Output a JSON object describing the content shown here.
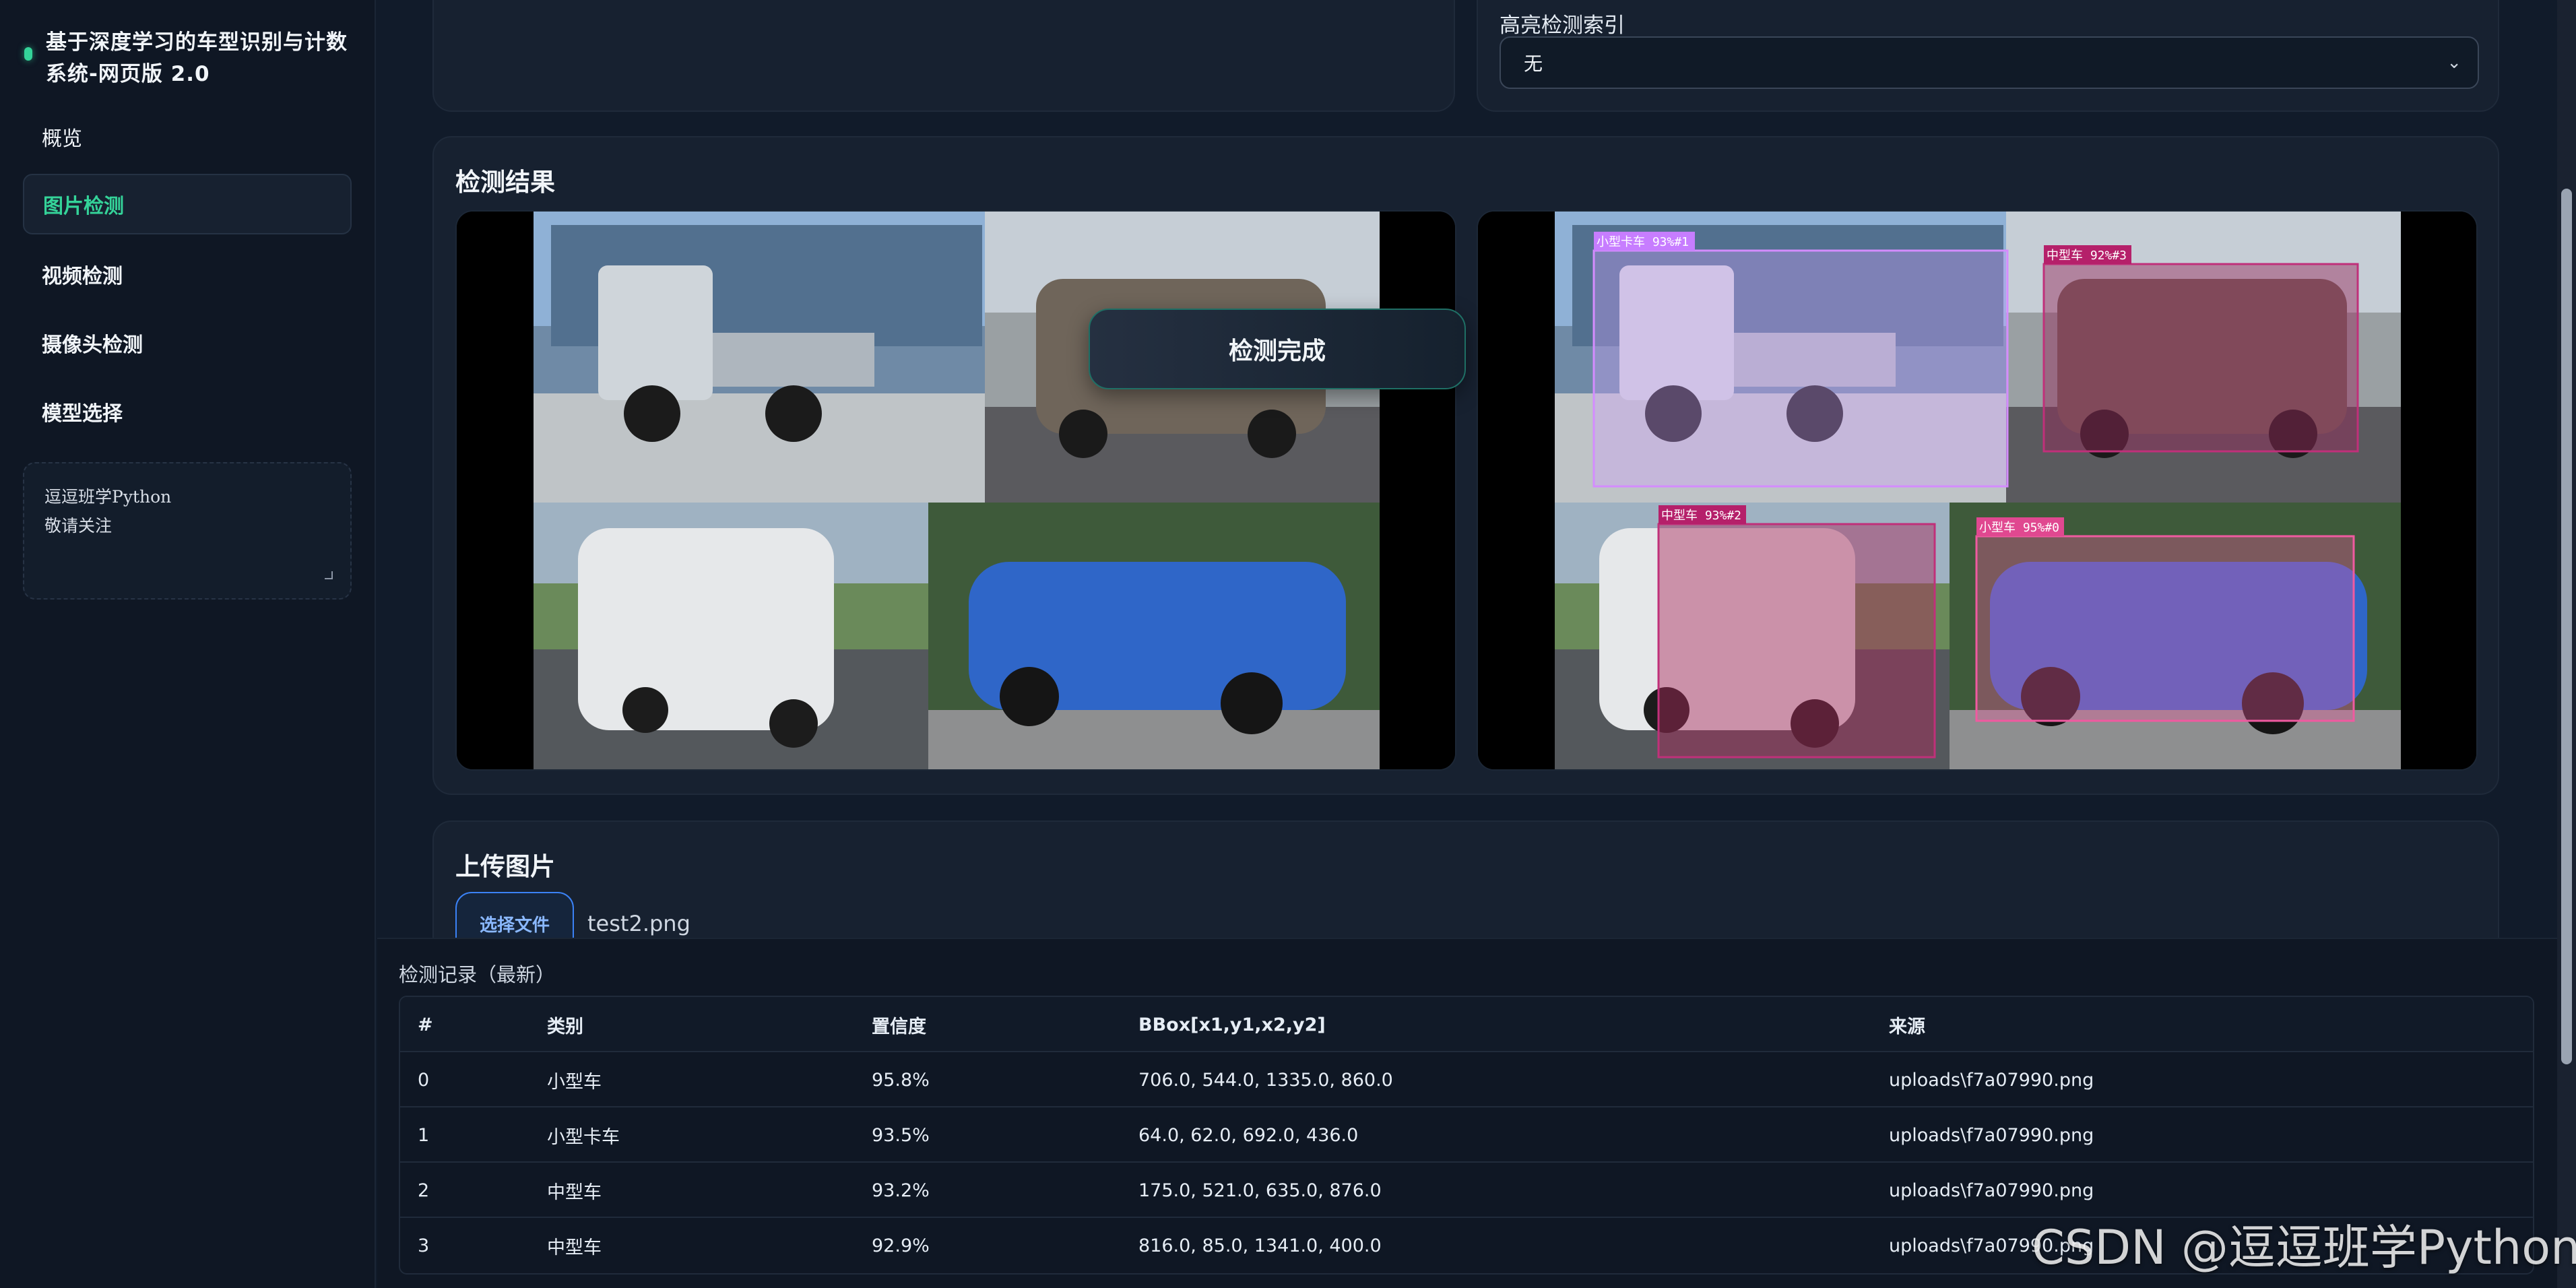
{
  "sidebar": {
    "brand_title": "基于深度学习的车型识别与计数系统-网页版 2.0",
    "items": [
      {
        "label": "概览"
      },
      {
        "label": "图片检测"
      },
      {
        "label": "视频检测"
      },
      {
        "label": "摄像头检测"
      },
      {
        "label": "模型选择"
      }
    ],
    "note_text": "逗逗班学Python\n敬请关注"
  },
  "main": {
    "highlight_label": "高亮检测索引",
    "highlight_value": "无"
  },
  "detection_results": {
    "title": "检测结果",
    "toast": "检测完成",
    "annotations": [
      {
        "label": "小型卡车 93%#1"
      },
      {
        "label": "中型车 92%#3"
      },
      {
        "label": "中型车 93%#2"
      },
      {
        "label": "小型车 95%#0"
      }
    ]
  },
  "upload_section": {
    "title": "上传图片",
    "choose_file": "选择文件",
    "file_name": "test2.png"
  },
  "records": {
    "title": "检测记录（最新）",
    "headers": [
      "#",
      "类别",
      "置信度",
      "BBox[x1,y1,x2,y2]",
      "来源"
    ],
    "rows": [
      [
        "0",
        "小型车",
        "95.8%",
        "706.0, 544.0, 1335.0, 860.0",
        "uploads\\f7a07990.png"
      ],
      [
        "1",
        "小型卡车",
        "93.5%",
        "64.0, 62.0, 692.0, 436.0",
        "uploads\\f7a07990.png"
      ],
      [
        "2",
        "中型车",
        "93.2%",
        "175.0, 521.0, 635.0, 876.0",
        "uploads\\f7a07990.png"
      ],
      [
        "3",
        "中型车",
        "92.9%",
        "816.0, 85.0, 1341.0, 400.0",
        "uploads\\f7a07990.png"
      ]
    ]
  },
  "watermark": "CSDN @逗逗班学Python",
  "colors": {
    "accent": "#34d399",
    "button_border": "#3b82f6",
    "background": "#111b2a"
  }
}
